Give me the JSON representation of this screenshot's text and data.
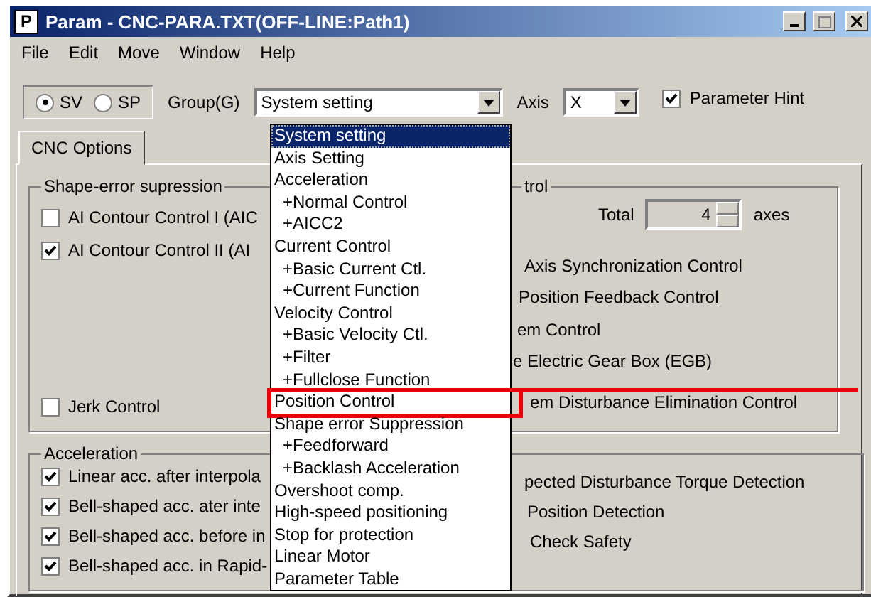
{
  "window": {
    "icon_letter": "P",
    "title": "Param - CNC-PARA.TXT(OFF-LINE:Path1)"
  },
  "menu": [
    "File",
    "Edit",
    "Move",
    "Window",
    "Help"
  ],
  "toolbar": {
    "modes": [
      {
        "label": "SV",
        "selected": true
      },
      {
        "label": "SP",
        "selected": false
      }
    ],
    "group_label": "Group(G)",
    "group_value": "System setting",
    "axis_label": "Axis",
    "axis_value": "X",
    "hint": {
      "label": "Parameter Hint",
      "checked": true
    }
  },
  "tabs": [
    {
      "label": "CNC Options",
      "selected": true
    }
  ],
  "shape_error_group": {
    "title": "Shape-error supression",
    "options": [
      {
        "label": "AI Contour Control I (AIC",
        "checked": false
      },
      {
        "label": "AI Contour Control II (AI",
        "checked": true
      }
    ],
    "bottom_option": {
      "label": "Jerk Control",
      "checked": false
    }
  },
  "control_group": {
    "title": "trol",
    "total_label": "Total",
    "total_value": "4",
    "total_unit": "axes",
    "options": [
      "Axis Synchronization Control",
      "Position Feedback Control",
      "em Control",
      "e Electric Gear Box (EGB)",
      "em Disturbance Elimination Control"
    ]
  },
  "acceleration_group": {
    "title": "Acceleration",
    "options": [
      {
        "label": "Linear acc. after interpola",
        "checked": true
      },
      {
        "label": "Bell-shaped acc. ater inte",
        "checked": true
      },
      {
        "label": "Bell-shaped acc. before in",
        "checked": true
      },
      {
        "label": "Bell-shaped acc. in Rapid-",
        "checked": true
      }
    ],
    "right_options": [
      "pected Disturbance Torque Detection",
      "Position Detection",
      "Check Safety"
    ]
  },
  "group_dropdown": {
    "items": [
      {
        "label": "System setting",
        "selected": true,
        "highlighted": false
      },
      {
        "label": "Axis Setting",
        "selected": false,
        "highlighted": false
      },
      {
        "label": "Acceleration",
        "selected": false,
        "highlighted": false,
        "children": [
          {
            "label": "+Normal Control",
            "selected": false,
            "highlighted": false
          },
          {
            "label": "+AICC2",
            "selected": false,
            "highlighted": false
          }
        ]
      },
      {
        "label": "Current Control",
        "selected": false,
        "highlighted": false,
        "children": [
          {
            "label": "+Basic Current Ctl.",
            "selected": false,
            "highlighted": false
          },
          {
            "label": "+Current Function",
            "selected": false,
            "highlighted": false
          }
        ]
      },
      {
        "label": "Velocity Control",
        "selected": false,
        "highlighted": false,
        "children": [
          {
            "label": "+Basic Velocity Ctl.",
            "selected": false,
            "highlighted": false
          },
          {
            "label": "+Filter",
            "selected": false,
            "highlighted": false
          },
          {
            "label": "+Fullclose Function",
            "selected": false,
            "highlighted": false
          }
        ]
      },
      {
        "label": "Position Control",
        "selected": false,
        "highlighted": true
      },
      {
        "label": "Shape error Suppression",
        "selected": false,
        "highlighted": false,
        "children": [
          {
            "label": "+Feedforward",
            "selected": false,
            "highlighted": false
          },
          {
            "label": "+Backlash Acceleration",
            "selected": false,
            "highlighted": false
          }
        ]
      },
      {
        "label": "Overshoot comp.",
        "selected": false,
        "highlighted": false
      },
      {
        "label": "High-speed positioning",
        "selected": false,
        "highlighted": false
      },
      {
        "label": "Stop for protection",
        "selected": false,
        "highlighted": false
      },
      {
        "label": "Linear Motor",
        "selected": false,
        "highlighted": false
      },
      {
        "label": "Parameter Table",
        "selected": false,
        "highlighted": false
      }
    ]
  }
}
